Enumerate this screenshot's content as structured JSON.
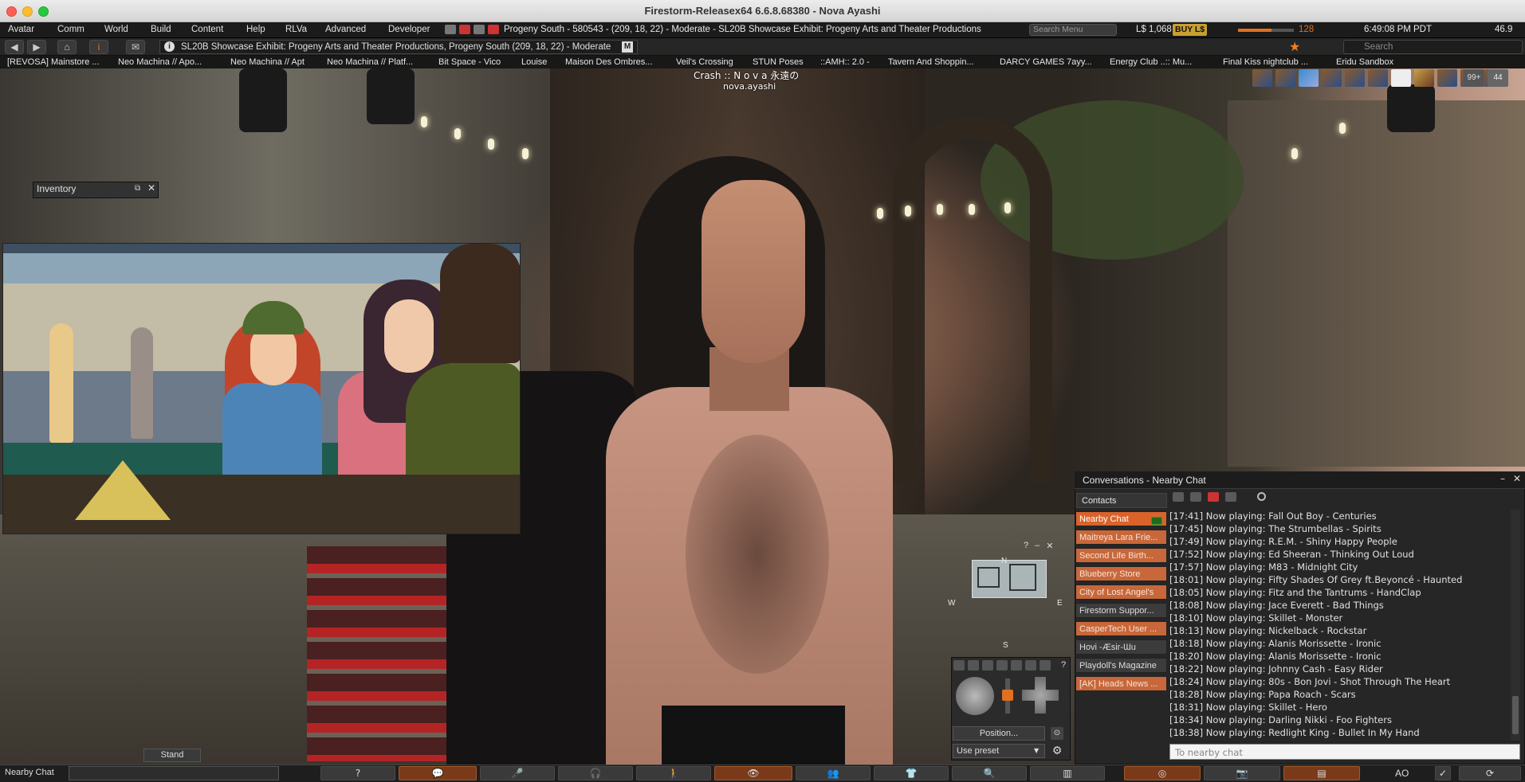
{
  "window": {
    "title": "Firestorm-Releasex64 6.6.8.68380 - Nova Ayashi"
  },
  "menu_bar": {
    "items": [
      "Avatar",
      "Comm",
      "World",
      "Build",
      "Content",
      "Help",
      "RLVa",
      "Advanced",
      "Developer"
    ],
    "location": "Progeny South - 580543 - (209, 18, 22) - Moderate - SL20B Showcase Exhibit: Progeny Arts and Theater Productions",
    "search_placeholder": "Search Menu",
    "balance": "L$ 1,068",
    "buy_label": "BUY L$",
    "bandwidth_value": "128",
    "bandwidth_fraction": 0.6,
    "clock": "6:49:08 PM PDT",
    "fps": "46.9"
  },
  "nav_bar": {
    "address": "SL20B Showcase Exhibit: Progeny Arts and Theater Productions, Progeny South (209, 18, 22) - Moderate",
    "maturity": "M",
    "search_placeholder": "Search"
  },
  "favorites": [
    "[REVOSA] Mainstore ...",
    "Neo Machina // Apo...",
    "Neo Machina // Apt",
    "Neo Machina // Platf...",
    "Bit Space - Vico",
    "Louise",
    "Maison Des Ombres...",
    "Veil's Crossing",
    "STUN Poses",
    "::AMH:: 2.0 -",
    "Tavern And Shoppin...",
    "DARCY GAMES 7ayy...",
    "Energy Club ..:: Mu...",
    "Final Kiss nightclub ...",
    "Eridu Sandbox"
  ],
  "nametag": {
    "line1": "Crash :: N o v a 永遠の",
    "line2": "nova.ayashi"
  },
  "toolbar_badges": {
    "count1": "99+",
    "count2": "44"
  },
  "inventory": {
    "title": "Inventory"
  },
  "minimap": {
    "north": "N",
    "west": "W",
    "east": "E",
    "south": "S",
    "help": "?",
    "minimize": "–",
    "close": "✕"
  },
  "camera": {
    "help": "?",
    "position_label": "Position...",
    "preset_value": "Use preset"
  },
  "conversations": {
    "title": "Conversations - Nearby Chat",
    "contacts_label": "Contacts",
    "tabs": [
      {
        "label": "Nearby Chat",
        "style": "active"
      },
      {
        "label": "Maitreya Lara Frie...",
        "style": "orange"
      },
      {
        "label": "Second Life Birth...",
        "style": "orange"
      },
      {
        "label": "Blueberry Store",
        "style": "orange"
      },
      {
        "label": "City of Lost Angel's",
        "style": "orange"
      },
      {
        "label": "Firestorm Suppor...",
        "style": "grey"
      },
      {
        "label": "CasperTech User ...",
        "style": "orange"
      },
      {
        "label": "Hovi -Æsir-Ɯu",
        "style": "grey"
      },
      {
        "label": "Playdoll's Magazine",
        "style": "grey"
      },
      {
        "label": "[AK] Heads News ...",
        "style": "orange"
      }
    ],
    "messages": [
      "[17:41] Now playing: Fall Out Boy - Centuries",
      "[17:45] Now playing: The Strumbellas - Spirits",
      "[17:49] Now playing: R.E.M. - Shiny Happy People",
      "[17:52] Now playing: Ed Sheeran - Thinking Out Loud",
      "[17:57] Now playing: M83 - Midnight City",
      "[18:01] Now playing: Fifty Shades Of Grey ft.Beyoncé - Haunted",
      "[18:05] Now playing: Fitz and the Tantrums - HandClap",
      "[18:08] Now playing: Jace Everett - Bad Things",
      "[18:10] Now playing: Skillet - Monster",
      "[18:13] Now playing: Nickelback - Rockstar",
      "[18:18] Now playing: Alanis Morissette - Ironic",
      "[18:20] Now playing: Alanis Morissette - Ironic",
      "[18:22] Now playing: Johnny Cash - Easy Rider",
      "[18:24] Now playing: 80s - Bon Jovi - Shot Through The Heart",
      "[18:28] Now playing: Papa Roach - Scars",
      "[18:31] Now playing: Skillet - Hero",
      "[18:34] Now playing: Darling Nikki - Foo Fighters",
      "[18:38] Now playing: Redlight King - Bullet In My Hand"
    ],
    "input_placeholder": "To nearby chat"
  },
  "stand_label": "Stand",
  "bottom_bar": {
    "nearby_label": "Nearby Chat",
    "ao_label": "AO"
  },
  "colors": {
    "accent": "#d9632b",
    "tab_orange": "#c8673a",
    "menu_bg": "#1b1b1b"
  }
}
